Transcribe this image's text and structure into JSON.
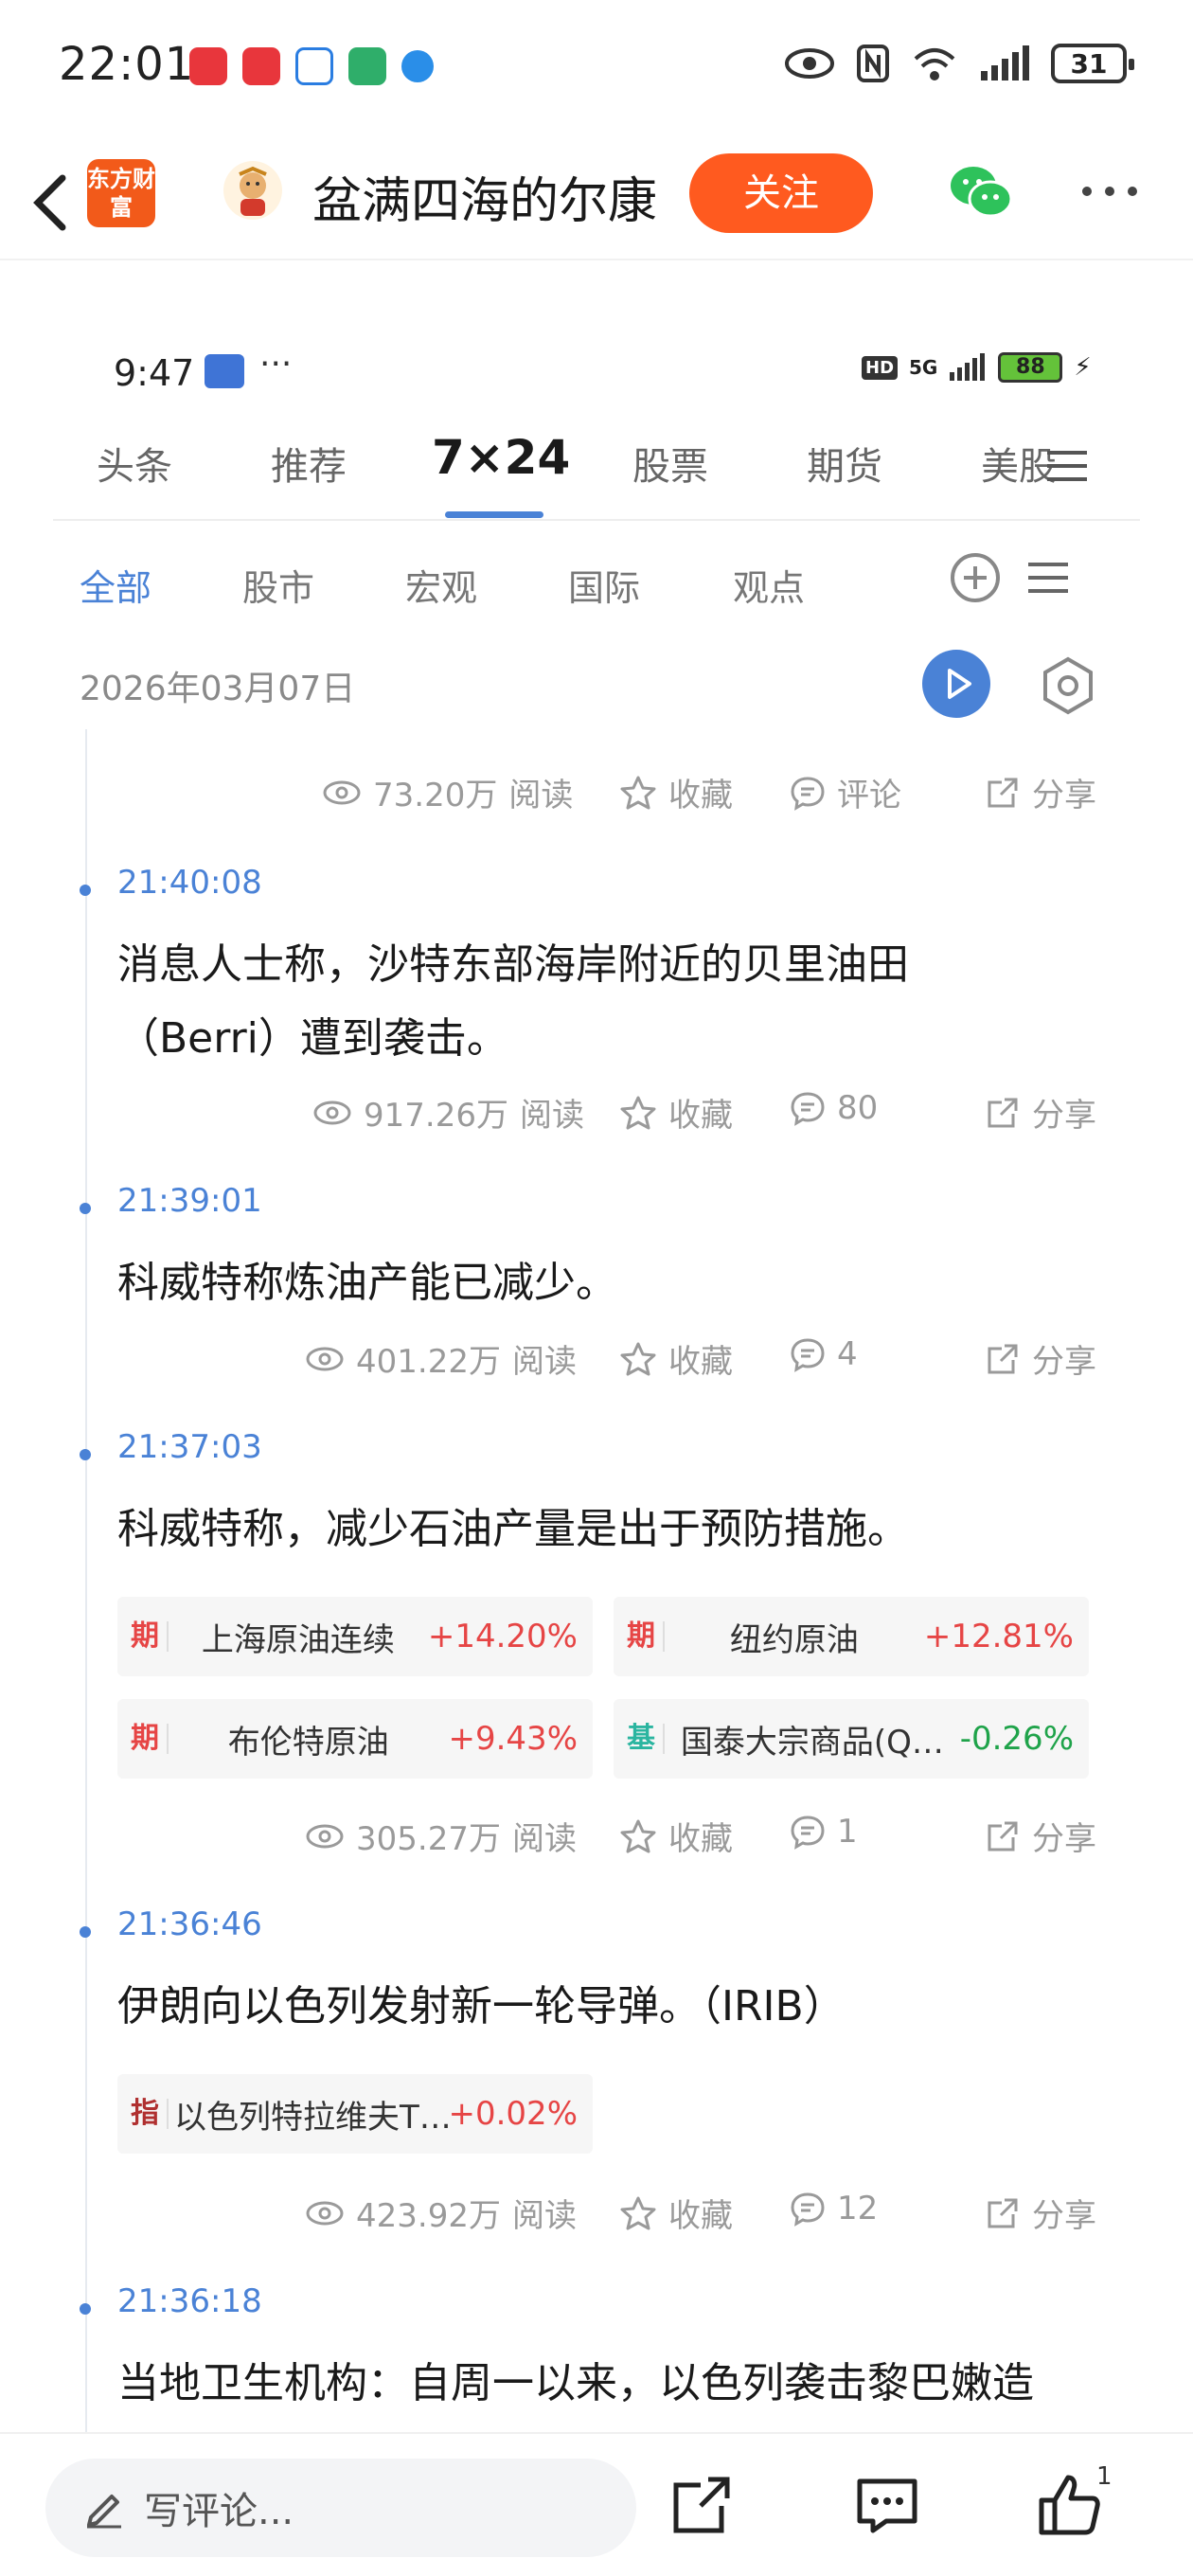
{
  "status_bar": {
    "time": "22:01",
    "battery": "31",
    "network": "6"
  },
  "header": {
    "logo_text": "东方财富",
    "author_name": "盆满四海的尔康",
    "follow_label": "关注"
  },
  "inner_status_bar": {
    "time": "9:47",
    "dots": "···",
    "hd": "HD",
    "network": "5G",
    "battery": "88"
  },
  "tabs": {
    "items": [
      "头条",
      "推荐",
      "7×24",
      "股票",
      "期货",
      "美股"
    ],
    "active": "7×24"
  },
  "subtabs": {
    "items": [
      "全部",
      "股市",
      "宏观",
      "国际",
      "观点"
    ],
    "active": "全部"
  },
  "date": "2026年03月07日",
  "action_labels": {
    "read": "阅读",
    "fav": "收藏",
    "comment": "评论",
    "share": "分享"
  },
  "first_stats": {
    "reads": "73.20万"
  },
  "news": [
    {
      "time": "21:40:08",
      "text_line1": "消息人士称，沙特东部海岸附近的贝里油田",
      "text_line2": "（Berri）遭到袭击。",
      "reads": "917.26万",
      "comments": "80"
    },
    {
      "time": "21:39:01",
      "text_line1": "科威特称炼油产能已减少。",
      "reads": "401.22万",
      "comments": "4"
    },
    {
      "time": "21:37:03",
      "text_line1": "科威特称，减少石油产量是出于预防措施。",
      "reads": "305.27万",
      "comments": "1",
      "quotes": [
        {
          "tag": "期",
          "name": "上海原油连续",
          "change": "+14.20%"
        },
        {
          "tag": "期",
          "name": "纽约原油",
          "change": "+12.81%"
        },
        {
          "tag": "期",
          "name": "布伦特原油",
          "change": "+9.43%"
        },
        {
          "tag": "基",
          "name": "国泰大宗商品(Q…",
          "change": "-0.26%"
        }
      ]
    },
    {
      "time": "21:36:46",
      "text_line1": "伊朗向以色列发射新一轮导弹。（IRIB）",
      "reads": "423.92万",
      "comments": "12",
      "quotes": [
        {
          "tag": "指",
          "name": "以色列特拉维夫T…",
          "change": "+0.02%"
        }
      ]
    },
    {
      "time": "21:36:18",
      "text_line1": "当地卫生机构：自周一以来，以色列袭击黎巴嫩造"
    }
  ],
  "bottom_bar": {
    "comment_placeholder": "写评论...",
    "like_count": "1"
  },
  "colors": {
    "accent_blue": "#4a82d6",
    "follow_orange": "#ff5a1f",
    "up_red": "#e64545",
    "down_green": "#1fa34a"
  }
}
